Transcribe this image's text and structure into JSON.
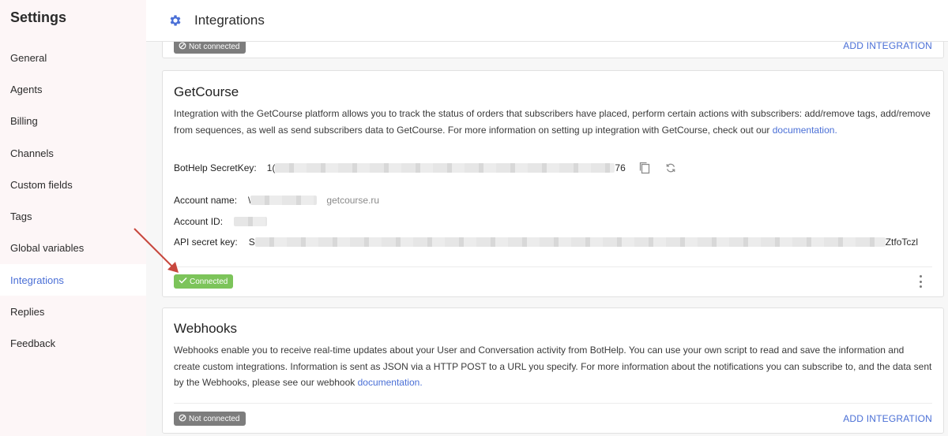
{
  "sidebar": {
    "title": "Settings",
    "items": [
      {
        "label": "General"
      },
      {
        "label": "Agents"
      },
      {
        "label": "Billing"
      },
      {
        "label": "Channels"
      },
      {
        "label": "Custom fields"
      },
      {
        "label": "Tags"
      },
      {
        "label": "Global variables"
      },
      {
        "label": "Integrations",
        "active": true
      },
      {
        "label": "Replies"
      },
      {
        "label": "Feedback"
      }
    ]
  },
  "header": {
    "title": "Integrations",
    "icon": "gear-icon"
  },
  "prev_card": {
    "status": "Not connected",
    "add_label": "ADD INTEGRATION"
  },
  "getcourse": {
    "title": "GetCourse",
    "description": "Integration with the GetCourse platform allows you to track the status of orders that subscribers have placed, perform certain actions with subscribers: add/remove tags, add/remove from sequences, as well as send subscribers data to GetCourse. For more information on setting up integration with GetCourse, check out our ",
    "doc_link": "documentation",
    "doc_suffix": ".",
    "secret_key_label": "BotHelp SecretKey:",
    "secret_key_start": "1(",
    "secret_key_end": "76",
    "account_name_label": "Account name:",
    "account_name_start": "\\",
    "account_name_domain": "getcourse.ru",
    "account_id_label": "Account ID:",
    "api_key_label": "API secret key:",
    "api_key_start": "S",
    "api_key_end": "ZtfoTczl",
    "status": "Connected",
    "colors": {
      "connected": "#7cc45a"
    }
  },
  "webhooks": {
    "title": "Webhooks",
    "description": "Webhooks enable you to receive real-time updates about your User and Conversation activity from BotHelp. You can use your own script to read and save the information and create custom integrations. Information is sent as JSON via a HTTP POST to a URL you specify. For more information about the notifications you can subscribe to, and the data sent by the Webhooks, please see our webhook ",
    "doc_link": "documentation",
    "doc_suffix": ".",
    "status": "Not connected",
    "add_label": "ADD INTEGRATION"
  },
  "colors": {
    "accent": "#4a6fd6",
    "annotation_arrow": "#c8483e"
  }
}
